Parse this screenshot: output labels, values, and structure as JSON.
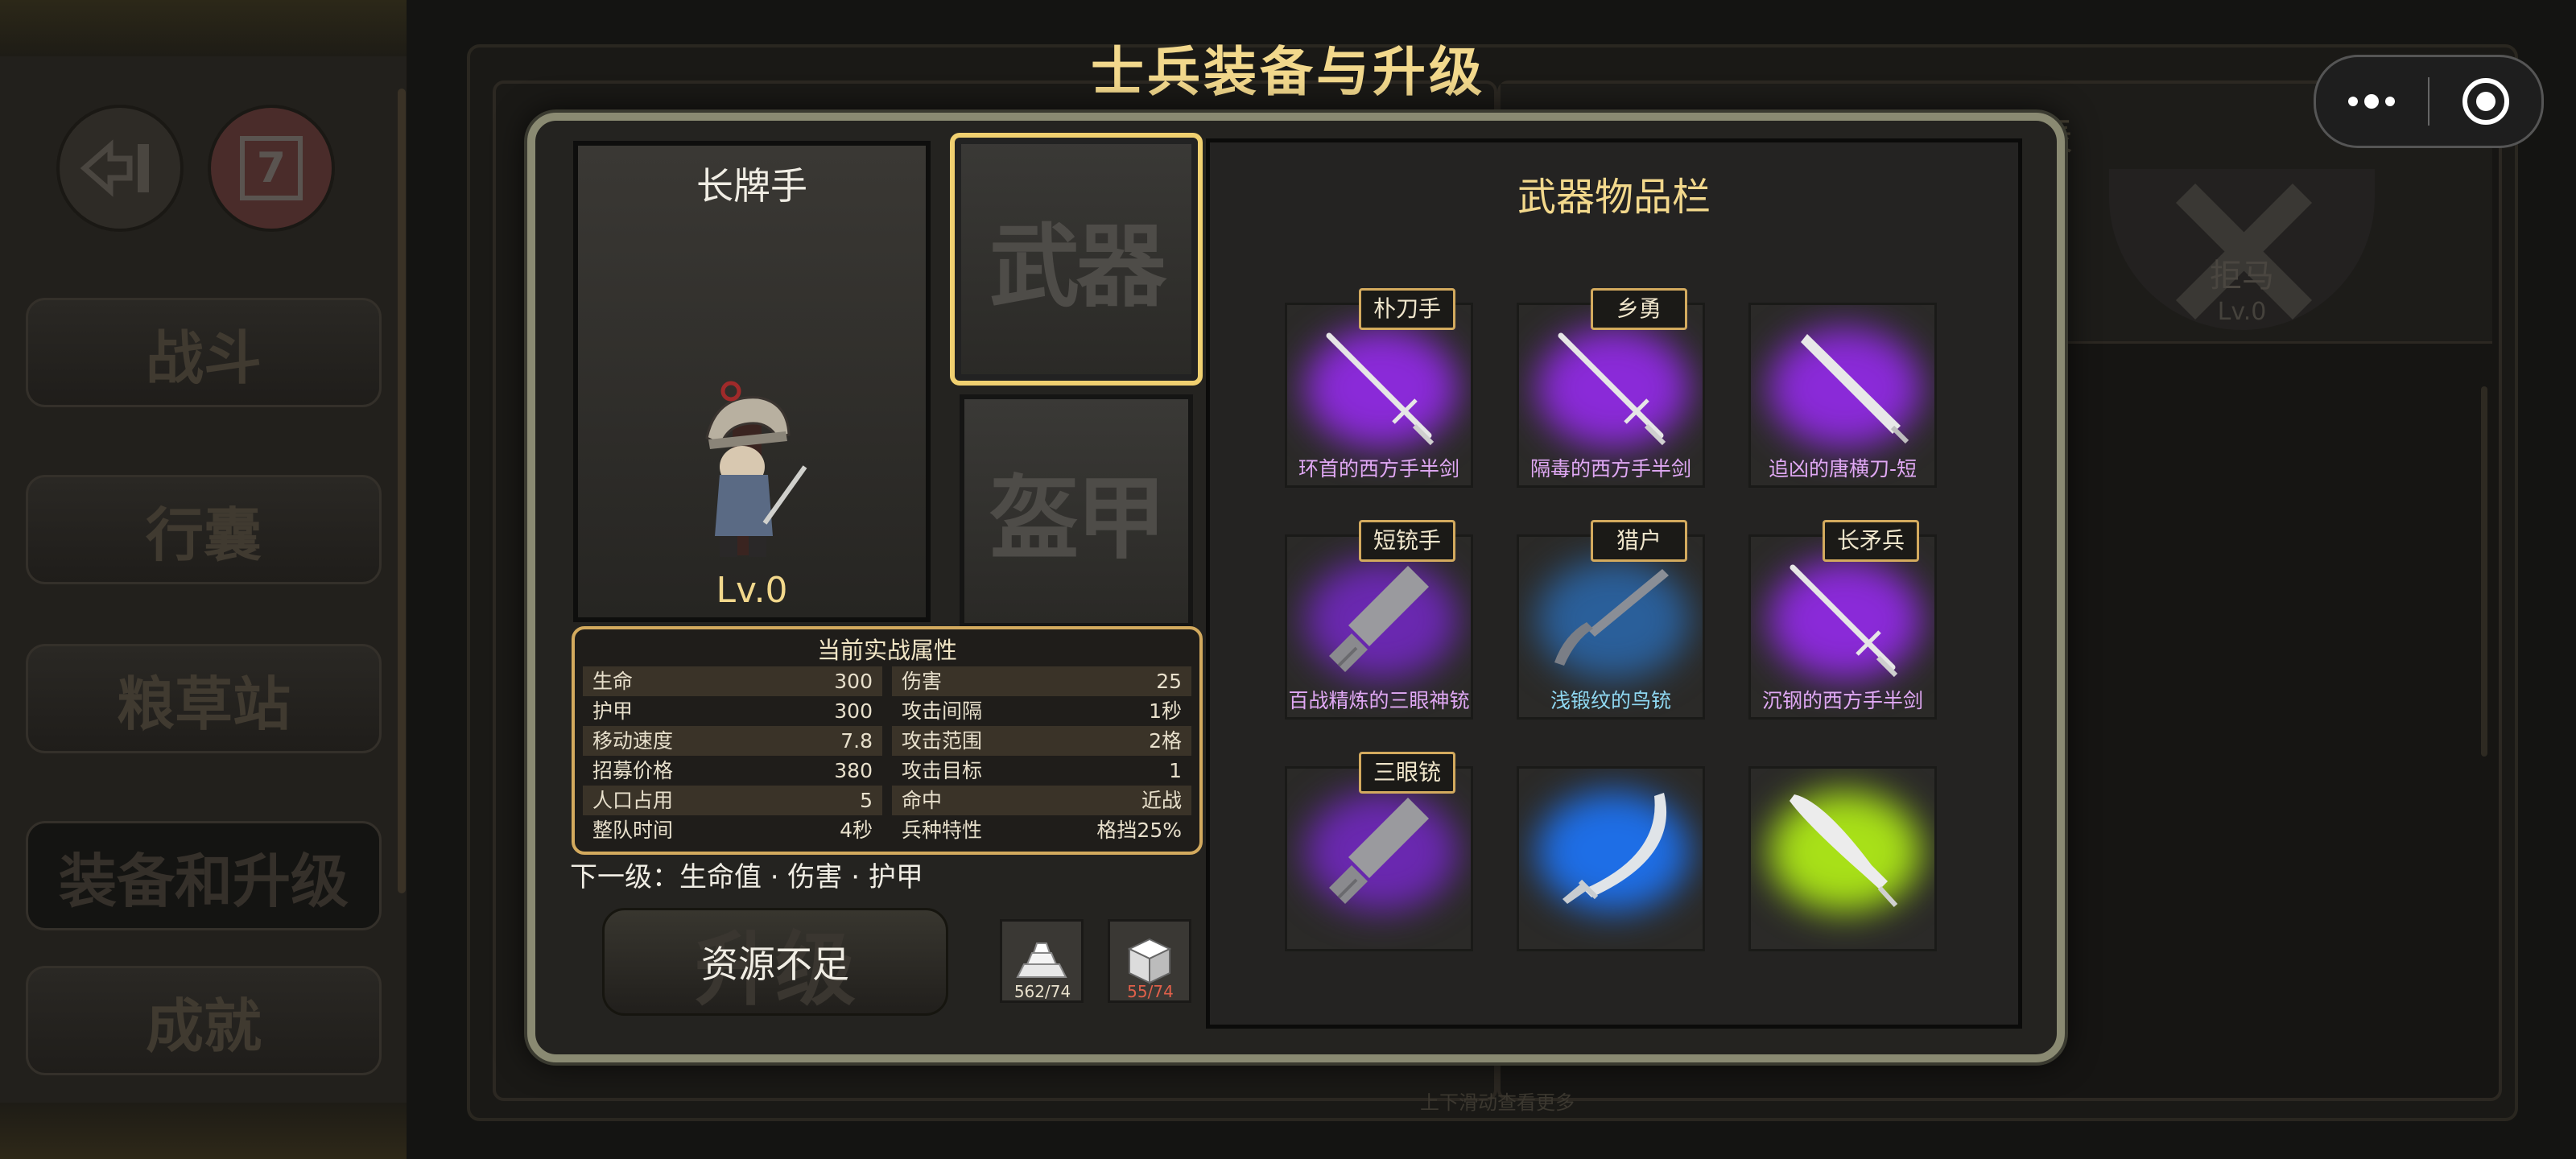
{
  "screen": {
    "title": "士兵装备与升级"
  },
  "sidebar": {
    "calendar_label": "7",
    "tabs": [
      {
        "label": "战斗",
        "active": false
      },
      {
        "label": "行囊",
        "active": false
      },
      {
        "label": "粮草站",
        "active": false
      },
      {
        "label": "装备和升级",
        "active": true
      },
      {
        "label": "成就",
        "active": false
      }
    ]
  },
  "background": {
    "right_header_tail": "表",
    "juma": {
      "label": "拒马",
      "level": "Lv.0"
    },
    "scroll_hint": "上下滑动查看更多"
  },
  "unit": {
    "name": "长牌手",
    "level": "Lv.0",
    "slots": {
      "weapon": "武器",
      "armor": "盔甲"
    }
  },
  "stats": {
    "title": "当前实战属性",
    "rows": [
      {
        "label": "生命",
        "value": "300",
        "label2": "伤害",
        "value2": "25"
      },
      {
        "label": "护甲",
        "value": "300",
        "label2": "攻击间隔",
        "value2": "1秒"
      },
      {
        "label": "移动速度",
        "value": "7.8",
        "label2": "攻击范围",
        "value2": "2格"
      },
      {
        "label": "招募价格",
        "value": "380",
        "label2": "攻击目标",
        "value2": "1"
      },
      {
        "label": "人口占用",
        "value": "5",
        "label2": "命中",
        "value2": "近战"
      },
      {
        "label": "整队时间",
        "value": "4秒",
        "label2": "兵种特性",
        "value2": "格挡25%"
      }
    ]
  },
  "next_level": {
    "text": "下一级：生命值 · 伤害 · 护甲"
  },
  "upgrade": {
    "label": "资源不足",
    "ghost": "升级"
  },
  "resources": [
    {
      "icon": "silver-ingot-icon",
      "count": "562/74"
    },
    {
      "icon": "white-cube-icon",
      "count": "55/74"
    }
  ],
  "inventory": {
    "title": "武器物品栏",
    "items": [
      {
        "tag": "朴刀手",
        "name": "环首的西方手半剑",
        "glow": "#8a2ad8",
        "icon": "sword-icon",
        "name_color": "#e0a8f4"
      },
      {
        "tag": "乡勇",
        "name": "隔毒的西方手半剑",
        "glow": "#8a2ad8",
        "icon": "sword-icon",
        "name_color": "#e0a8f4"
      },
      {
        "tag": "",
        "name": "追凶的唐横刀-短",
        "glow": "#8a2ad8",
        "icon": "blade-icon",
        "name_color": "#e0a8f4"
      },
      {
        "tag": "短铳手",
        "name": "百战精炼的三眼神铳",
        "glow": "#6a28b0",
        "icon": "gun-icon",
        "name_color": "#e0a8f4"
      },
      {
        "tag": "猎户",
        "name": "浅锻纹的鸟铳",
        "glow": "#2a5f9a",
        "icon": "musket-icon",
        "name_color": "#8fd8f2"
      },
      {
        "tag": "长矛兵",
        "name": "沉钢的西方手半剑",
        "glow": "#8a2ad8",
        "icon": "sword-icon",
        "name_color": "#e0a8f4"
      },
      {
        "tag": "三眼铳",
        "name": "",
        "glow": "#6a28b0",
        "icon": "gun-icon",
        "name_color": "#e0a8f4"
      },
      {
        "tag": "",
        "name": "",
        "glow": "#1e6ee6",
        "icon": "saber-icon",
        "name_color": "#8fd8f2"
      },
      {
        "tag": "",
        "name": "",
        "glow": "#a8e018",
        "icon": "dao-icon",
        "name_color": "#d8f0a0"
      }
    ]
  },
  "colors": {
    "gold": "#f2d88c",
    "border_gold": "#d3aa5e",
    "purple": "#8a2ad8",
    "blue": "#1e6ee6",
    "green": "#a8e018"
  }
}
